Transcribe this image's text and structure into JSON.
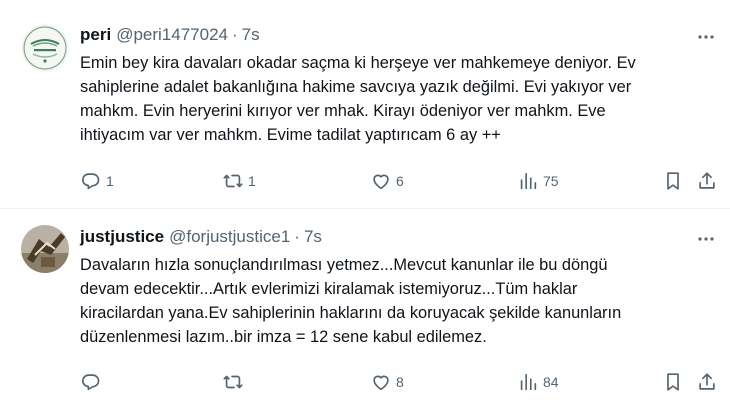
{
  "tweets": [
    {
      "name": "peri",
      "handle": "@peri1477024",
      "dot": "·",
      "time": "7s",
      "text": "Emin bey kira davaları okadar saçma ki herşeye ver mahkemeye deniyor. Ev\nsahiplerine adalet bakanlığına hakime savcıya yazık değilmi. Evi yakıyor ver\nmahkm. Evin heryerini kırıyor ver mhak. Kirayı ödeniyor ver mahkm. Eve\nihtiyacım var ver mahkm. Evime tadilat yaptırıcam 6 ay ++",
      "replies": "1",
      "retweets": "1",
      "likes": "6",
      "views": "75",
      "avatar_icon": "circular-logo-avatar"
    },
    {
      "name": "justjustice",
      "handle": "@forjustjustice1",
      "dot": "·",
      "time": "7s",
      "text": "Davaların hızla sonuçlandırılması yetmez...Mevcut kanunlar ile bu döngü\ndevam edecektir...Artık evlerimizi kiralamak istemiyoruz...Tüm haklar\nkiracilardan yana.Ev sahiplerinin haklarını da koruyacak şekilde kanunların\ndüzenlenmesi lazım..bir imza = 12 sene kabul edilemez.",
      "replies": "",
      "retweets": "",
      "likes": "8",
      "views": "84",
      "avatar_icon": "photo-avatar"
    }
  ],
  "colors": {
    "text": "#0f1419",
    "muted": "#536471",
    "divider": "#eff3f4"
  }
}
